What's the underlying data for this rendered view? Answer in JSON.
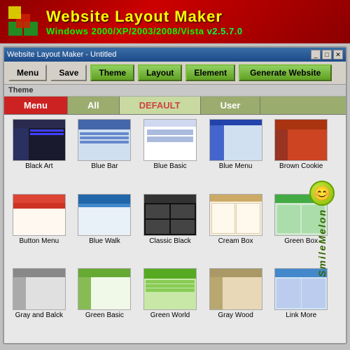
{
  "app": {
    "title": "Website Layout Maker",
    "subtitle": "Windows  2000/XP/2003/2008/Vista",
    "version": "v2.5.7.0",
    "window_title": "Website Layout Maker - Untitled"
  },
  "toolbar": {
    "menu_label": "Menu",
    "save_label": "Save",
    "theme_label": "Theme",
    "layout_label": "Layout",
    "element_label": "Element",
    "generate_label": "Generate Website"
  },
  "section": {
    "label": "Theme"
  },
  "tabs": [
    {
      "id": "menu",
      "label": "Menu",
      "state": "active-red"
    },
    {
      "id": "all",
      "label": "All",
      "state": ""
    },
    {
      "id": "default",
      "label": "DEFAULT",
      "state": "active-default"
    },
    {
      "id": "user",
      "label": "User",
      "state": ""
    }
  ],
  "themes": [
    {
      "id": "black-art",
      "name": "Black Art"
    },
    {
      "id": "blue-bar",
      "name": "Blue Bar"
    },
    {
      "id": "blue-basic",
      "name": "Blue Basic"
    },
    {
      "id": "blue-menu",
      "name": "Blue Menu"
    },
    {
      "id": "brown-cookie",
      "name": "Brown Cookie"
    },
    {
      "id": "button-menu",
      "name": "Button Menu"
    },
    {
      "id": "blue-walk",
      "name": "Blue Walk"
    },
    {
      "id": "classic-black",
      "name": "Classic Black"
    },
    {
      "id": "cream-box",
      "name": "Cream Box"
    },
    {
      "id": "green-box",
      "name": "Green Box"
    },
    {
      "id": "gray-back",
      "name": "Gray and Balck"
    },
    {
      "id": "green-basic",
      "name": "Green Basic"
    },
    {
      "id": "green-world",
      "name": "Green World"
    },
    {
      "id": "gray-wood",
      "name": "Gray Wood"
    },
    {
      "id": "link-more",
      "name": "Link More"
    }
  ],
  "side_brand": "SmileMelon",
  "window_controls": {
    "minimize": "_",
    "maximize": "□",
    "close": "✕"
  }
}
